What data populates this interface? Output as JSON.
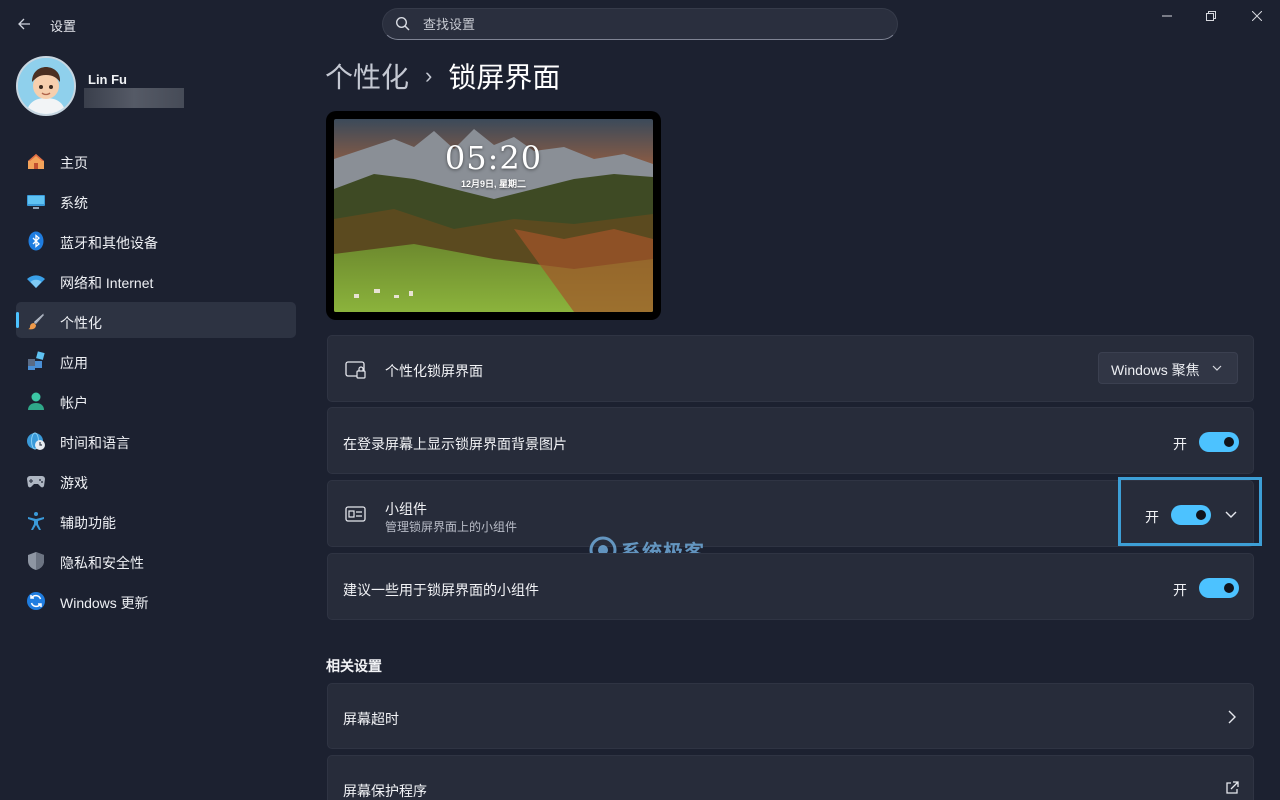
{
  "titlebar": {
    "app_title": "设置",
    "search_placeholder": "查找设置"
  },
  "profile": {
    "name": "Lin Fu"
  },
  "sidebar": {
    "items": [
      {
        "label": "主页",
        "icon": "home-icon"
      },
      {
        "label": "系统",
        "icon": "monitor-icon"
      },
      {
        "label": "蓝牙和其他设备",
        "icon": "bluetooth-icon"
      },
      {
        "label": "网络和 Internet",
        "icon": "wifi-icon"
      },
      {
        "label": "个性化",
        "icon": "paintbrush-icon",
        "active": true
      },
      {
        "label": "应用",
        "icon": "apps-icon"
      },
      {
        "label": "帐户",
        "icon": "person-icon"
      },
      {
        "label": "时间和语言",
        "icon": "globe-clock-icon"
      },
      {
        "label": "游戏",
        "icon": "gamepad-icon"
      },
      {
        "label": "辅助功能",
        "icon": "accessibility-icon"
      },
      {
        "label": "隐私和安全性",
        "icon": "shield-icon"
      },
      {
        "label": "Windows 更新",
        "icon": "update-icon"
      }
    ]
  },
  "breadcrumb": {
    "parent": "个性化",
    "separator": "›",
    "current": "锁屏界面"
  },
  "preview": {
    "time": "05:20",
    "date": "12月9日, 星期二"
  },
  "settings": {
    "personalize_lock": {
      "title": "个性化锁屏界面",
      "value": "Windows 聚焦"
    },
    "show_bg_on_signin": {
      "title": "在登录屏幕上显示锁屏界面背景图片",
      "state": "开"
    },
    "widgets": {
      "title": "小组件",
      "subtitle": "管理锁屏界面上的小组件",
      "state": "开"
    },
    "suggest_widgets": {
      "title": "建议一些用于锁屏界面的小组件",
      "state": "开"
    }
  },
  "related": {
    "heading": "相关设置",
    "screen_timeout": "屏幕超时",
    "screensaver": "屏幕保护程序"
  },
  "watermark": {
    "text": "系统极客"
  },
  "colors": {
    "accent": "#4cc2ff",
    "background": "#1c2130",
    "card": "#272c3a",
    "highlight_border": "#3d9fd6"
  }
}
